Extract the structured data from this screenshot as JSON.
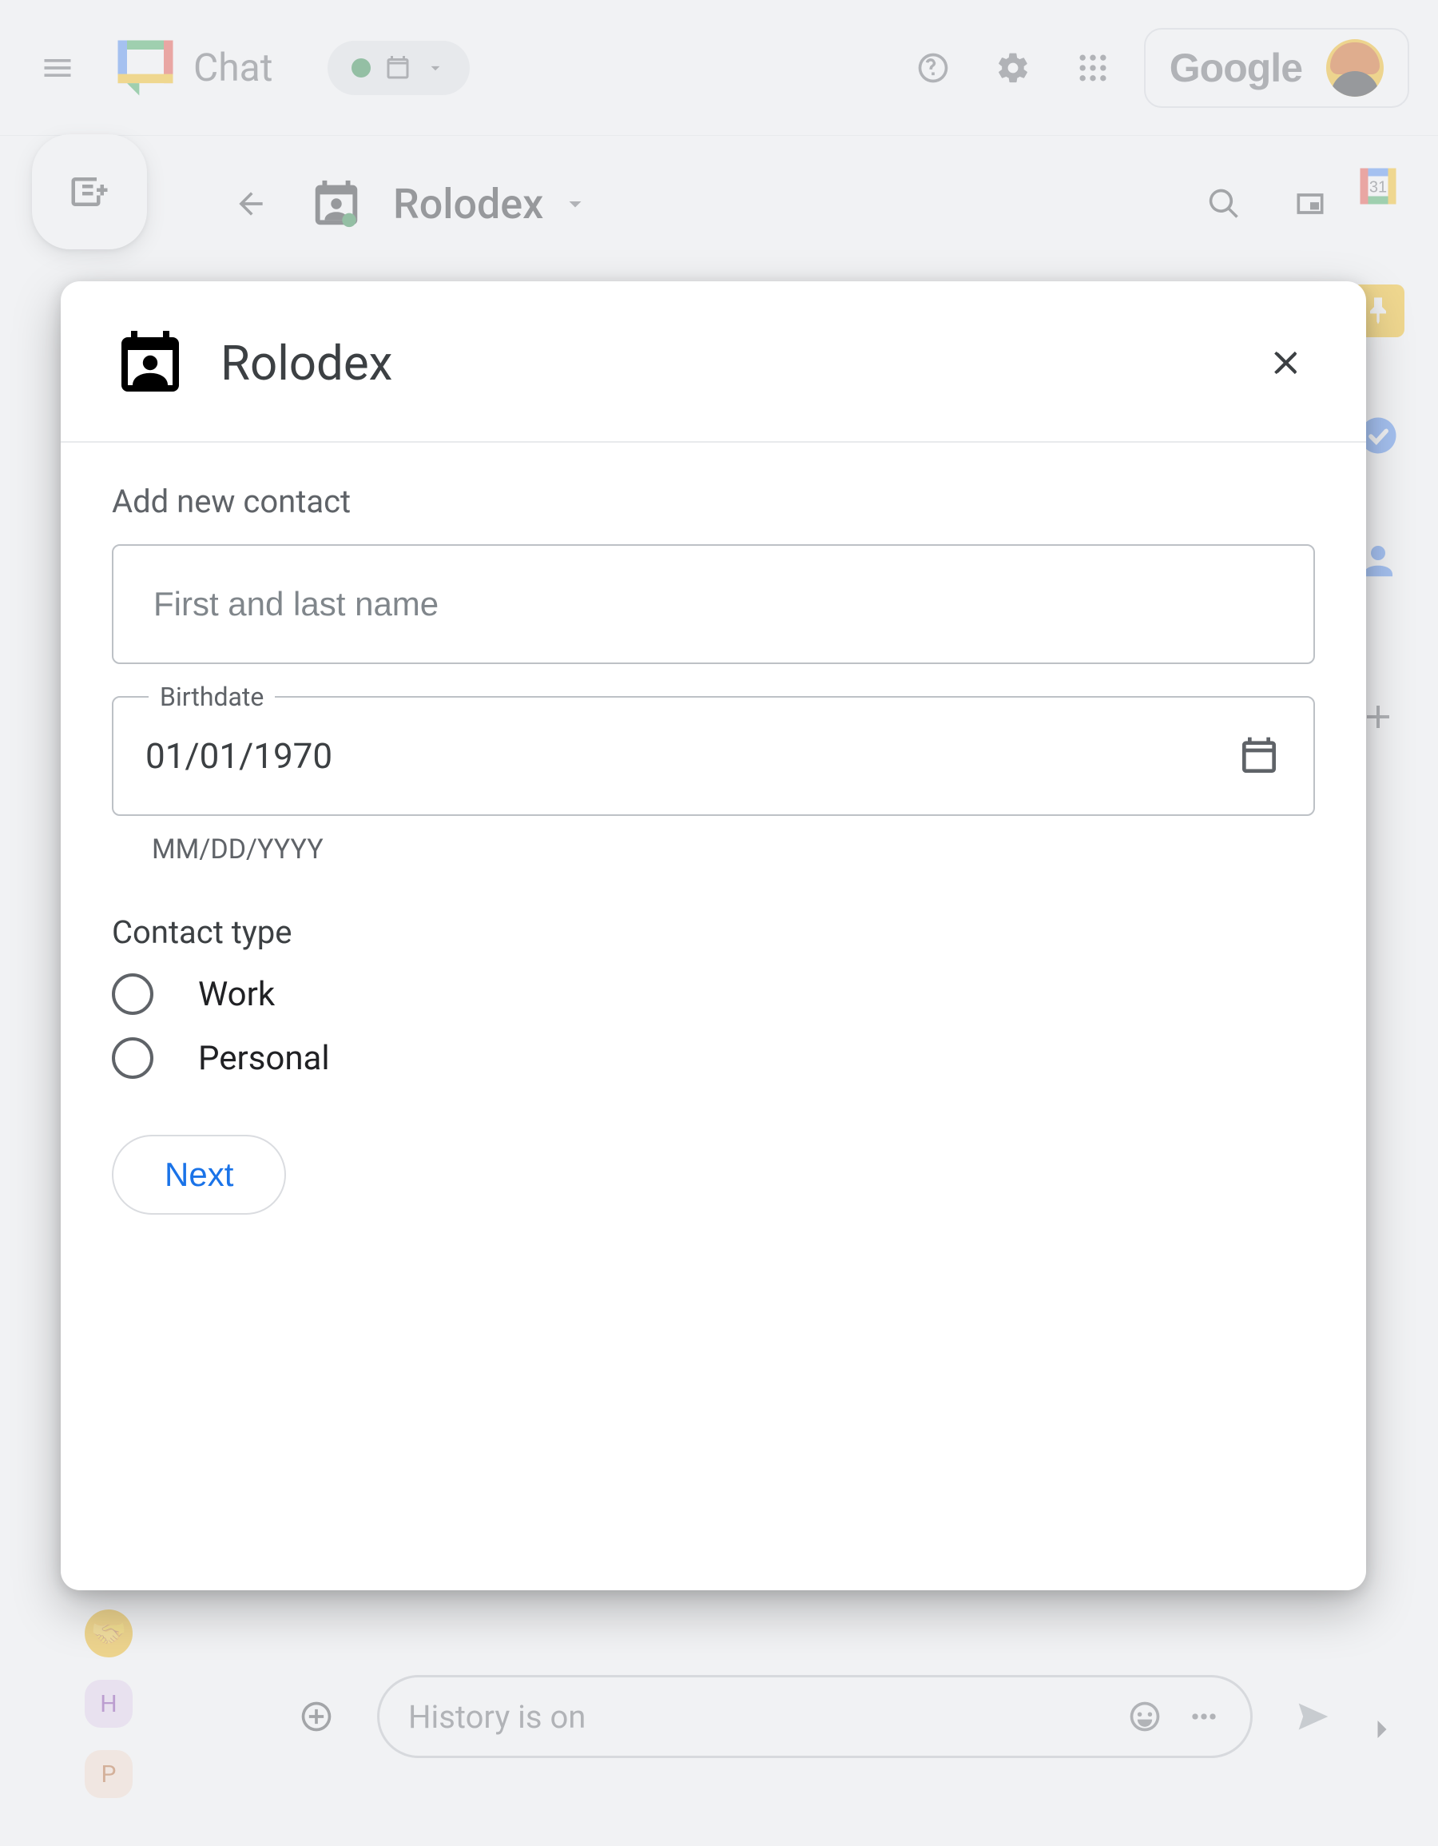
{
  "topbar": {
    "app_name": "Chat",
    "google_label": "Google"
  },
  "secondbar": {
    "space_name": "Rolodex",
    "calendar_day": "31"
  },
  "sidebar_minis": [
    {
      "letter": "",
      "bg": "#f4b400"
    },
    {
      "letter": "H",
      "bg": "#e8d5f2",
      "color": "#7b2fa5"
    },
    {
      "letter": "P",
      "bg": "#fde2cf",
      "color": "#b35a1f"
    }
  ],
  "compose": {
    "placeholder": "History is on"
  },
  "modal": {
    "title": "Rolodex",
    "section_label": "Add new contact",
    "name_placeholder": "First and last name",
    "birthdate_label": "Birthdate",
    "birthdate_value": "01/01/1970",
    "birthdate_helper": "MM/DD/YYYY",
    "contact_type_label": "Contact type",
    "radio_options": [
      "Work",
      "Personal"
    ],
    "next_label": "Next"
  }
}
